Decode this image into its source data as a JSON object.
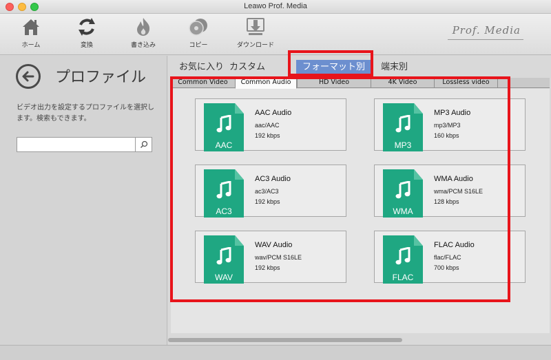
{
  "window": {
    "title": "Leawo Prof. Media"
  },
  "toolbar": {
    "items": [
      {
        "label": "ホーム",
        "icon": "home-icon"
      },
      {
        "label": "変換",
        "icon": "convert-icon"
      },
      {
        "label": "書き込み",
        "icon": "burn-icon"
      },
      {
        "label": "コピー",
        "icon": "copy-icon"
      },
      {
        "label": "ダウンロード",
        "icon": "download-icon"
      }
    ],
    "brand": "Prof. Media"
  },
  "sidebar": {
    "title": "プロファイル",
    "description": "ビデオ出力を設定するプロファイルを選択します。検索もできます。",
    "search": {
      "value": "",
      "placeholder": ""
    }
  },
  "category_tabs": [
    {
      "label": "お気に入り",
      "active": false
    },
    {
      "label": "カスタム",
      "active": false
    },
    {
      "label": "フォーマット別",
      "active": true
    },
    {
      "label": "端末別",
      "active": false
    }
  ],
  "sub_tabs": [
    {
      "label": "Common Video",
      "active": false
    },
    {
      "label": "Common Audio",
      "active": true
    },
    {
      "label": "HD Video",
      "active": false
    },
    {
      "label": "4K Video",
      "active": false
    },
    {
      "label": "Lossless video",
      "active": false
    }
  ],
  "profiles": [
    {
      "name": "AAC Audio",
      "codec": "aac/AAC",
      "bitrate": "192 kbps",
      "ext": "AAC"
    },
    {
      "name": "MP3 Audio",
      "codec": "mp3/MP3",
      "bitrate": "160 kbps",
      "ext": "MP3"
    },
    {
      "name": "AC3 Audio",
      "codec": "ac3/AC3",
      "bitrate": "192 kbps",
      "ext": "AC3"
    },
    {
      "name": "WMA Audio",
      "codec": "wma/PCM S16LE",
      "bitrate": "128 kbps",
      "ext": "WMA"
    },
    {
      "name": "WAV Audio",
      "codec": "wav/PCM S16LE",
      "bitrate": "192 kbps",
      "ext": "WAV"
    },
    {
      "name": "FLAC Audio",
      "codec": "flac/FLAC",
      "bitrate": "700 kbps",
      "ext": "FLAC"
    }
  ],
  "colors": {
    "accent_tab": "#6c8fcf",
    "file_icon": "#1fa782",
    "highlight": "#e8141b"
  }
}
